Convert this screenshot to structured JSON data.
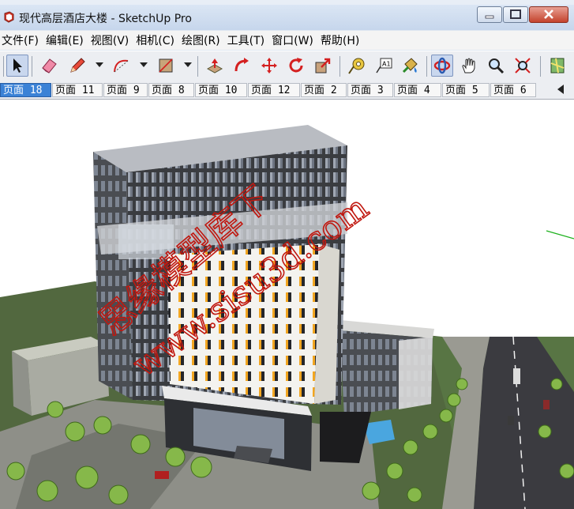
{
  "window": {
    "title": "现代高层酒店大楼 - SketchUp Pro"
  },
  "menubar": {
    "items": [
      {
        "label": "文件(F)"
      },
      {
        "label": "编辑(E)"
      },
      {
        "label": "视图(V)"
      },
      {
        "label": "相机(C)"
      },
      {
        "label": "绘图(R)"
      },
      {
        "label": "工具(T)"
      },
      {
        "label": "窗口(W)"
      },
      {
        "label": "帮助(H)"
      }
    ]
  },
  "toolbar": {
    "tools": [
      {
        "icon": "select-arrow-icon",
        "selected": false
      },
      {
        "icon": "eraser-icon",
        "selected": false
      },
      {
        "icon": "pencil-icon",
        "selected": false
      },
      {
        "icon": "arc-icon",
        "selected": false
      },
      {
        "icon": "rectangle-icon",
        "selected": false
      },
      {
        "icon": "push-pull-icon",
        "selected": false
      },
      {
        "icon": "follow-me-icon",
        "selected": false
      },
      {
        "icon": "move-icon",
        "selected": false
      },
      {
        "icon": "rotate-icon",
        "selected": false
      },
      {
        "icon": "scale-icon",
        "selected": false
      },
      {
        "icon": "tape-measure-icon",
        "selected": false
      },
      {
        "icon": "text-label-icon",
        "selected": false
      },
      {
        "icon": "paint-bucket-icon",
        "selected": false
      },
      {
        "icon": "orbit-icon",
        "selected": true
      },
      {
        "icon": "pan-hand-icon",
        "selected": false
      },
      {
        "icon": "zoom-icon",
        "selected": false
      },
      {
        "icon": "zoom-extents-icon",
        "selected": false
      },
      {
        "icon": "map-icon",
        "selected": false
      }
    ],
    "text_tool_glyph": "A1"
  },
  "scenes": {
    "tabs": [
      {
        "label": "页面 18",
        "active": true
      },
      {
        "label": "页面 11",
        "active": false
      },
      {
        "label": "页面 9",
        "active": false
      },
      {
        "label": "页面 8",
        "active": false
      },
      {
        "label": "页面 10",
        "active": false
      },
      {
        "label": "页面 12",
        "active": false
      },
      {
        "label": "页面 2",
        "active": false
      },
      {
        "label": "页面 3",
        "active": false
      },
      {
        "label": "页面 4",
        "active": false
      },
      {
        "label": "页面 5",
        "active": false
      },
      {
        "label": "页面 6",
        "active": false
      }
    ]
  },
  "watermark": {
    "line1": "思缘模型库下",
    "line2": "www.sisu3d.com"
  },
  "colors": {
    "accent": "#3b82d6",
    "watermark": "#c0170f",
    "ground": "#52683f",
    "road": "#3b3b40"
  }
}
